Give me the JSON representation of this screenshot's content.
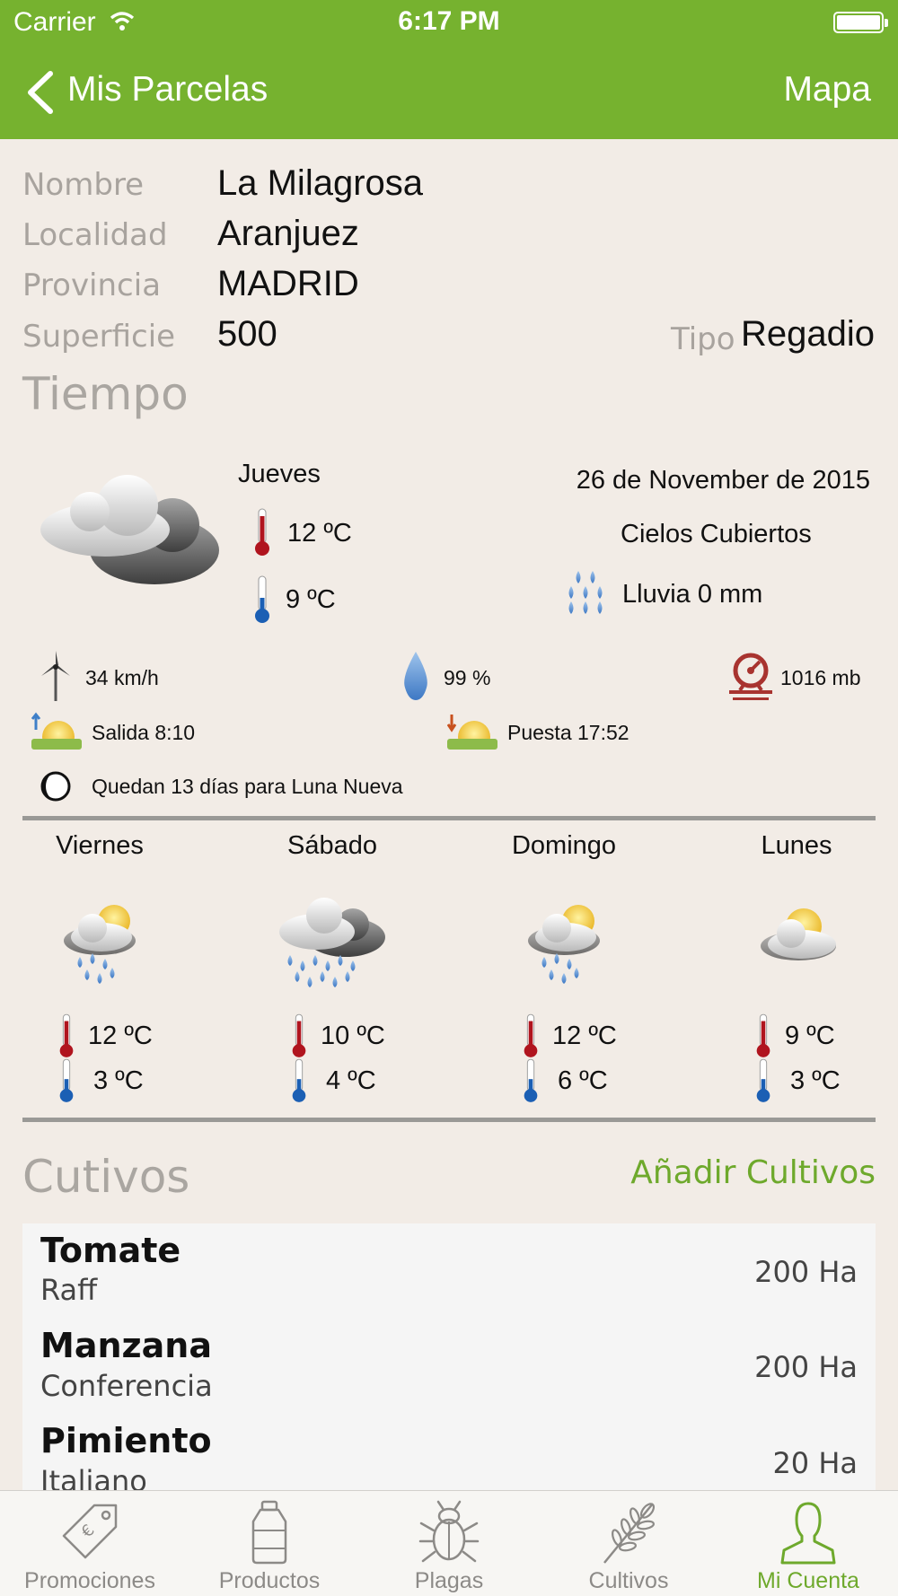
{
  "status": {
    "carrier": "Carrier",
    "time": "6:17 PM"
  },
  "nav": {
    "back_label": "Mis Parcelas",
    "right_label": "Mapa"
  },
  "info": {
    "nombre_label": "Nombre",
    "nombre": "La Milagrosa",
    "localidad_label": "Localidad",
    "localidad": "Aranjuez",
    "provincia_label": "Provincia",
    "provincia": "MADRID",
    "superficie_label": "Superficie",
    "superficie": "500",
    "tipo_label": "Tipo",
    "tipo": "Regadio"
  },
  "weather": {
    "section_title": "Tiempo",
    "today": {
      "day": "Jueves",
      "max": "12 ºC",
      "min": "9 ºC",
      "date": "26 de November de 2015",
      "condition": "Cielos Cubiertos",
      "rain": "Lluvia 0 mm",
      "wind": "34 km/h",
      "humidity": "99 %",
      "pressure": "1016 mb",
      "sunrise": "Salida 8:10",
      "sunset": "Puesta 17:52",
      "moon": "Quedan 13 días para Luna Nueva"
    },
    "forecast": [
      {
        "day": "Viernes",
        "max": "12 ºC",
        "min": "3 ºC",
        "icon": "sun-cloud-rain-icon"
      },
      {
        "day": "Sábado",
        "max": "10 ºC",
        "min": "4 ºC",
        "icon": "heavy-rain-icon"
      },
      {
        "day": "Domingo",
        "max": "12 ºC",
        "min": "6 ºC",
        "icon": "sun-cloud-rain-icon"
      },
      {
        "day": "Lunes",
        "max": "9 ºC",
        "min": "3 ºC",
        "icon": "sun-cloud-icon"
      }
    ]
  },
  "crops_section": {
    "title": "Cutivos",
    "add_label": "Añadir Cultivos",
    "items": [
      {
        "name": "Tomate",
        "variety": "Raff",
        "area": "200 Ha"
      },
      {
        "name": "Manzana",
        "variety": "Conferencia",
        "area": "200 Ha"
      },
      {
        "name": "Pimiento",
        "variety": "Italiano",
        "area": "20 Ha"
      }
    ]
  },
  "tabs": [
    {
      "label": "Promociones",
      "icon": "tag-icon"
    },
    {
      "label": "Productos",
      "icon": "bottle-icon"
    },
    {
      "label": "Plagas",
      "icon": "bug-icon"
    },
    {
      "label": "Cultivos",
      "icon": "wheat-icon"
    },
    {
      "label": "Mi Cuenta",
      "icon": "user-icon",
      "active": true
    }
  ],
  "colors": {
    "brand": "#76b22f",
    "accent_text": "#6ea92c",
    "background": "#f2ece6"
  }
}
